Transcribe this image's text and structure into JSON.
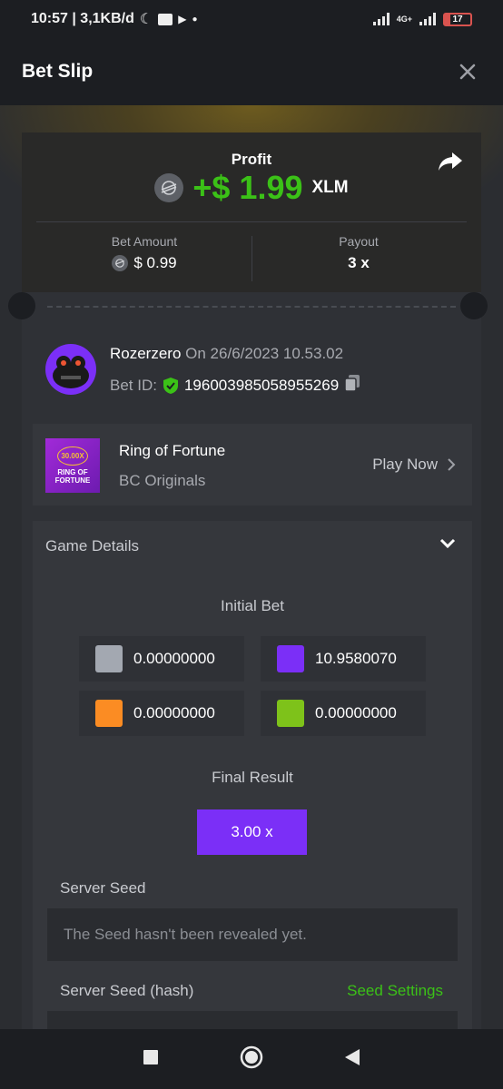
{
  "status_bar": {
    "time_info": "10:57 | 3,1KB/d",
    "network": "4G+",
    "battery": "17"
  },
  "header": {
    "title": "Bet Slip"
  },
  "profit": {
    "label": "Profit",
    "amount": "+$ 1.99",
    "currency": "XLM",
    "bet_amount_label": "Bet Amount",
    "bet_amount_value": "$ 0.99",
    "payout_label": "Payout",
    "payout_value": "3 x"
  },
  "user": {
    "name": "Rozerzero",
    "date": "On 26/6/2023 10.53.02",
    "bet_id_label": "Bet ID:",
    "bet_id": "196003985058955269"
  },
  "game": {
    "name": "Ring of Fortune",
    "provider": "BC Originals",
    "play_label": "Play Now",
    "thumb_multiplier": "30.00X",
    "thumb_title_1": "RING OF",
    "thumb_title_2": "FORTUNE"
  },
  "details": {
    "title": "Game Details",
    "initial_bet_label": "Initial Bet",
    "bets": [
      {
        "color": "#a3a8b1",
        "value": "0.00000000"
      },
      {
        "color": "#7b2ff7",
        "value": "10.9580070"
      },
      {
        "color": "#fb8c23",
        "value": "0.00000000"
      },
      {
        "color": "#7ec21a",
        "value": "0.00000000"
      }
    ],
    "final_result_label": "Final Result",
    "final_result": "3.00 x",
    "server_seed_label": "Server Seed",
    "server_seed_value": "The Seed hasn't been revealed yet.",
    "server_seed_hash_label": "Server Seed (hash)",
    "seed_settings": "Seed Settings"
  },
  "colors": {
    "accent_green": "#3bc117",
    "accent_purple": "#7b2ff7"
  }
}
